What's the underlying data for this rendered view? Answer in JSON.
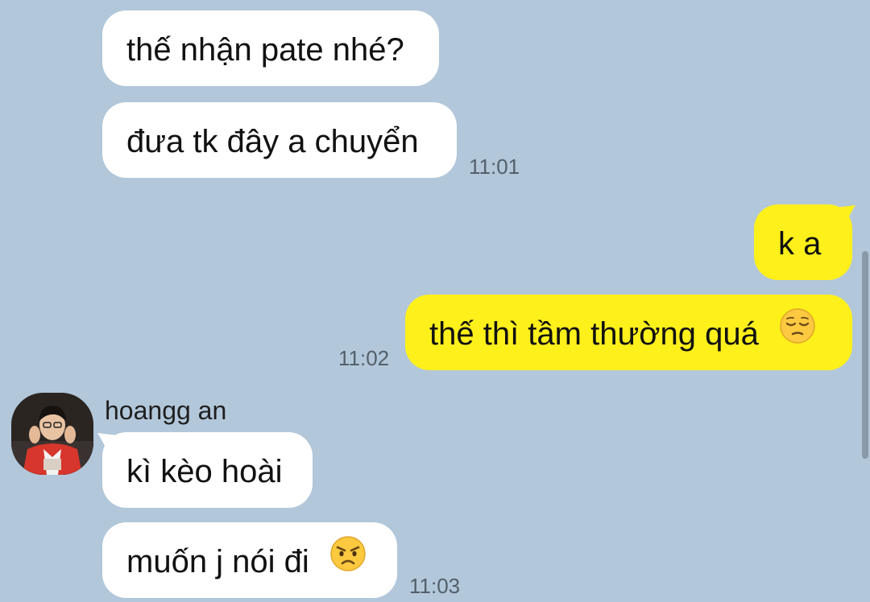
{
  "messages": [
    {
      "text": "thế nhận pate nhé?",
      "direction": "incoming"
    },
    {
      "text": "đưa tk đây a chuyển",
      "direction": "incoming",
      "time": "11:01"
    },
    {
      "text": "k a",
      "direction": "outgoing"
    },
    {
      "text": "thế thì tầm thường quá",
      "direction": "outgoing",
      "time": "11:02",
      "emoji": "pensive-face-emoji"
    },
    {
      "text": "kì kèo hoài",
      "direction": "incoming",
      "sender": "hoangg an"
    },
    {
      "text": "muốn j nói đi",
      "direction": "incoming",
      "time": "11:03",
      "emoji": "angry-face-emoji"
    }
  ],
  "colors": {
    "background": "#b2c7da",
    "incoming_bubble": "#ffffff",
    "outgoing_bubble": "#fef01b",
    "timestamp": "#53606b"
  }
}
